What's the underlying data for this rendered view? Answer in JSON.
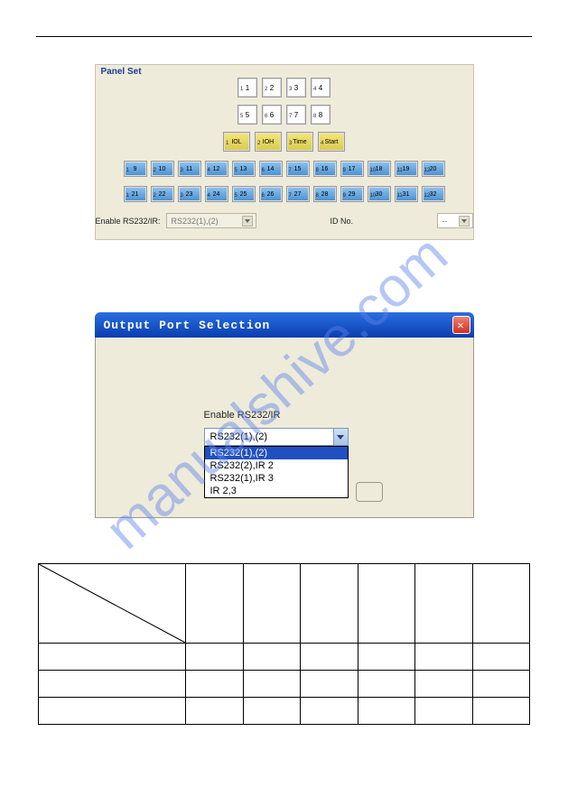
{
  "panel": {
    "title": "Panel Set",
    "row1": [
      {
        "sup": "1",
        "label": "1"
      },
      {
        "sup": "2",
        "label": "2"
      },
      {
        "sup": "3",
        "label": "3"
      },
      {
        "sup": "4",
        "label": "4"
      }
    ],
    "row2": [
      {
        "sup": "5",
        "label": "5"
      },
      {
        "sup": "6",
        "label": "6"
      },
      {
        "sup": "7",
        "label": "7"
      },
      {
        "sup": "8",
        "label": "8"
      }
    ],
    "row3": [
      {
        "sup": "1",
        "label": "IOL"
      },
      {
        "sup": "2",
        "label": "IOH"
      },
      {
        "sup": "3",
        "label": "Time"
      },
      {
        "sup": "4",
        "label": "Start"
      }
    ],
    "row4": [
      "9",
      "10",
      "11",
      "12",
      "13",
      "14",
      "15",
      "16",
      "17",
      "18",
      "19",
      "20"
    ],
    "row4_sup": [
      "1",
      "2",
      "3",
      "4",
      "5",
      "6",
      "7",
      "8",
      "9",
      "10",
      "11",
      "12"
    ],
    "row5": [
      "21",
      "22",
      "23",
      "24",
      "25",
      "26",
      "27",
      "28",
      "29",
      "30",
      "31",
      "32"
    ],
    "row5_sup": [
      "1",
      "2",
      "3",
      "4",
      "5",
      "6",
      "7",
      "8",
      "9",
      "10",
      "11",
      "12"
    ],
    "enable_label": "Enable RS232/IR:",
    "enable_value": "RS232(1),(2)",
    "idno_label": "ID No.",
    "idno_value": "--"
  },
  "dialog": {
    "title": "Output Port Selection",
    "enable_label": "Enable RS232/IR",
    "combo_value": "RS232(1),(2)",
    "options": [
      {
        "text": "RS232(1),(2)",
        "selected": true
      },
      {
        "text": "RS232(2),IR 2",
        "selected": false
      },
      {
        "text": "RS232(1),IR 3",
        "selected": false
      },
      {
        "text": "IR 2,3",
        "selected": false
      }
    ]
  },
  "watermark": "manualshive.com"
}
